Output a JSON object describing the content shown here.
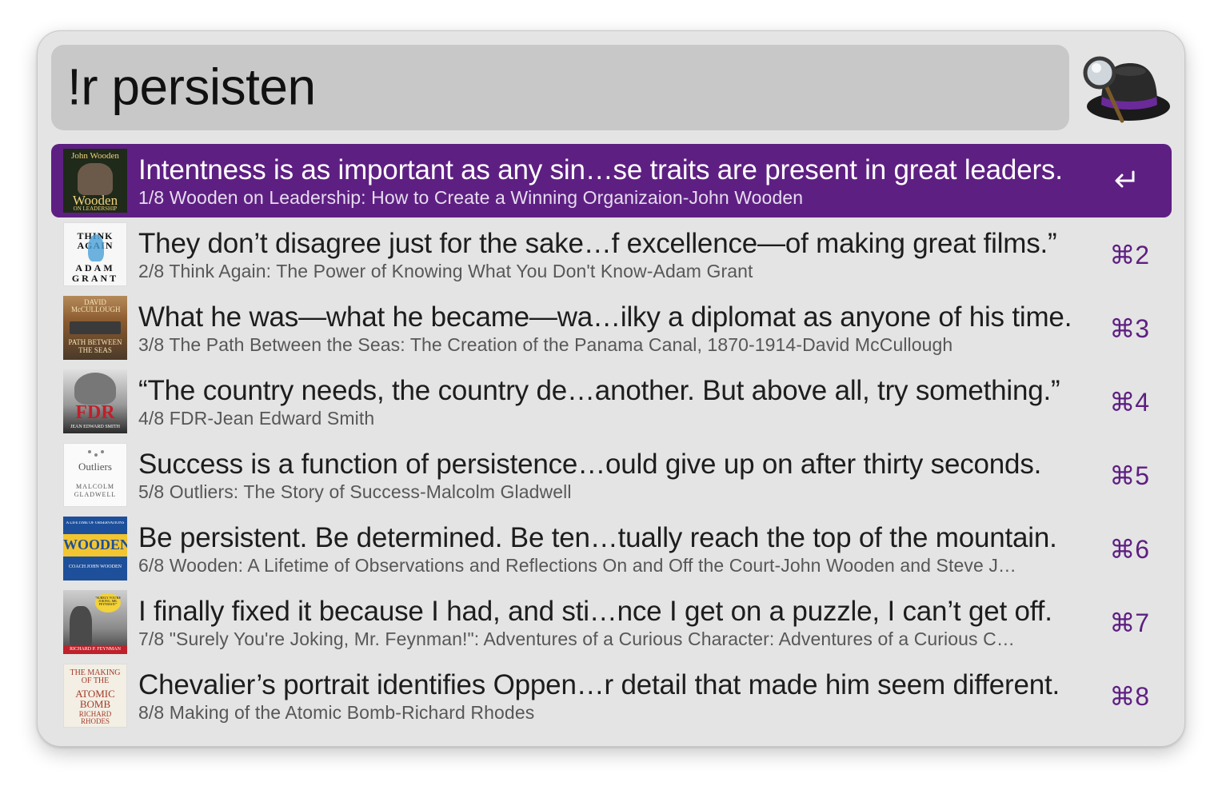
{
  "search": {
    "query": "!r persisten"
  },
  "results": [
    {
      "title": "Intentness is as important as any sin…se traits are present in great leaders.",
      "subtitle": "1/8 Wooden on Leadership: How to Create a Winning Organizaion-John Wooden",
      "shortcut": "",
      "cover": {
        "line1": "John Wooden",
        "line2": "Wooden",
        "line3": "ON LEADERSHIP",
        "bg": "#1f2a1a",
        "fg": "#f1d27a"
      }
    },
    {
      "title": "They don’t disagree just for the sake…f excellence—of making great films.”",
      "subtitle": "2/8 Think Again: The Power of Knowing What You Don't Know-Adam Grant",
      "shortcut": "⌘2",
      "cover": {
        "line1": "THINK AGAIN",
        "line2": "ADAM",
        "line3": "GRANT",
        "bg": "#f7f7f7",
        "fg": "#111111"
      }
    },
    {
      "title": "What he was—what he became—wa…ilky a diplomat as anyone of his time.",
      "subtitle": "3/8 The Path Between the Seas: The Creation of the Panama Canal, 1870-1914-David McCullough",
      "shortcut": "⌘3",
      "cover": {
        "line1": "DAVID McCULLOUGH",
        "line2": "PATH BETWEEN",
        "line3": "THE SEAS",
        "bg": "#8a5a2e",
        "fg": "#f5e3b8"
      }
    },
    {
      "title": "“The country needs, the country de…another. But above all, try something.”",
      "subtitle": "4/8 FDR-Jean Edward Smith",
      "shortcut": "⌘4",
      "cover": {
        "line1": "",
        "line2": "FDR",
        "line3": "JEAN EDWARD SMITH",
        "bg": "#bdbdbd",
        "fg": "#c0202a"
      }
    },
    {
      "title": "Success is a function of persistence…ould give up on after thirty seconds.",
      "subtitle": "5/8 Outliers: The Story of Success-Malcolm Gladwell",
      "shortcut": "⌘5",
      "cover": {
        "line1": "Outliers",
        "line2": "MALCOLM",
        "line3": "GLADWELL",
        "bg": "#fafafa",
        "fg": "#555555"
      }
    },
    {
      "title": "Be persistent. Be determined. Be ten…tually reach the top of the mountain.",
      "subtitle": "6/8 Wooden: A Lifetime of Observations and Reflections On and Off the Court-John Wooden and Steve J…",
      "shortcut": "⌘6",
      "cover": {
        "line1": "A LIFETIME OF OBSERVATIONS",
        "line2": "WOODEN",
        "line3": "COACH JOHN WOODEN",
        "bg": "#1e4f9a",
        "fg": "#f2c531"
      }
    },
    {
      "title": "I finally fixed it because I had, and sti…nce I get on a puzzle, I can’t get off.",
      "subtitle": "7/8 \"Surely You're Joking, Mr. Feynman!\": Adventures of a Curious Character: Adventures of a Curious C…",
      "shortcut": "⌘7",
      "cover": {
        "line1": "\"SURELY YOU'RE JOKING, MR. FEYNMAN!\"",
        "line2": "",
        "line3": "RICHARD P. FEYNMAN",
        "bg": "#5a5a5a",
        "fg": "#f3d23a"
      }
    },
    {
      "title": "Chevalier’s portrait identifies Oppen…r detail that made him seem different.",
      "subtitle": "8/8 Making of the Atomic Bomb-Richard Rhodes",
      "shortcut": "⌘8",
      "cover": {
        "line1": "THE MAKING OF THE",
        "line2": "ATOMIC BOMB",
        "line3": "RICHARD RHODES",
        "bg": "#f3efe4",
        "fg": "#a33a2a"
      }
    }
  ]
}
